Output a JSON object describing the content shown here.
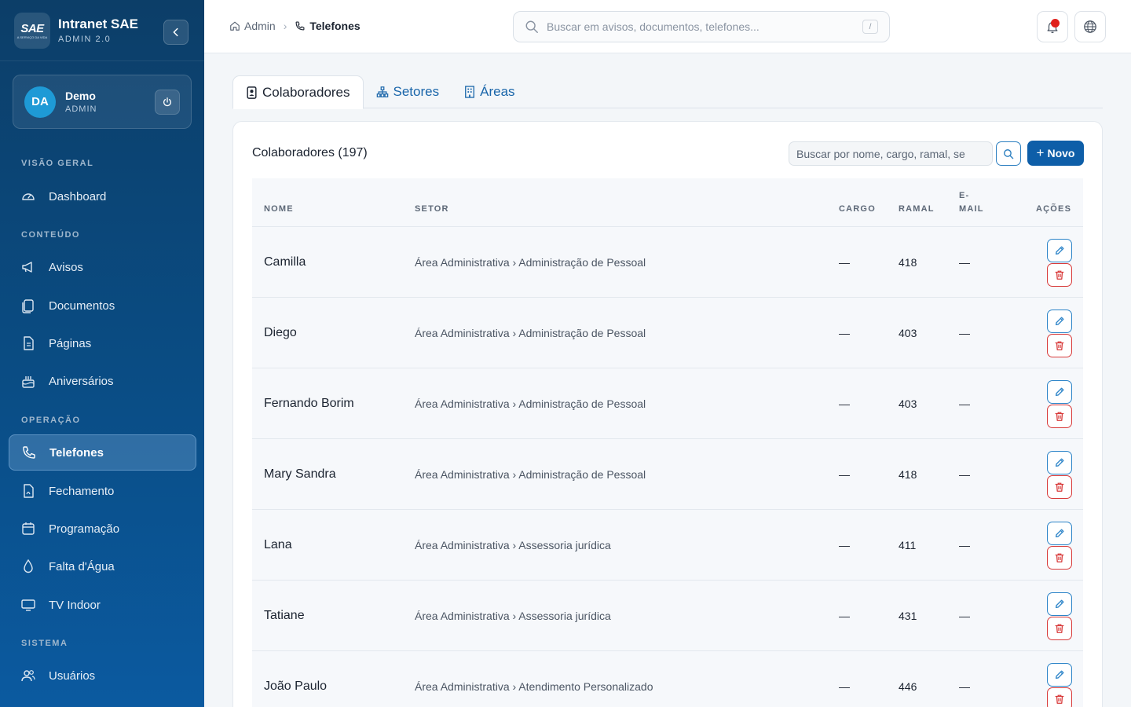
{
  "brand": {
    "logo_text": "SAE",
    "logo_tagline": "A SERVIÇO DA VIDA",
    "title": "Intranet SAE",
    "subtitle": "ADMIN 2.0"
  },
  "user": {
    "initials": "DA",
    "name": "Demo",
    "role": "ADMIN"
  },
  "sidebar": {
    "sections": [
      "VISÃO GERAL",
      "CONTEÚDO",
      "OPERAÇÃO",
      "SISTEMA"
    ],
    "items": [
      {
        "label": "Dashboard",
        "icon": "gauge-icon"
      },
      {
        "label": "Avisos",
        "icon": "megaphone-icon"
      },
      {
        "label": "Documentos",
        "icon": "documents-icon"
      },
      {
        "label": "Páginas",
        "icon": "page-icon"
      },
      {
        "label": "Aniversários",
        "icon": "cake-icon"
      },
      {
        "label": "Telefones",
        "icon": "phone-icon",
        "active": true
      },
      {
        "label": "Fechamento",
        "icon": "file-pdf-icon"
      },
      {
        "label": "Programação",
        "icon": "calendar-icon"
      },
      {
        "label": "Falta d'Água",
        "icon": "droplet-icon"
      },
      {
        "label": "TV Indoor",
        "icon": "monitor-icon"
      },
      {
        "label": "Usuários",
        "icon": "users-icon"
      }
    ]
  },
  "breadcrumb": {
    "root": "Admin",
    "current": "Telefones"
  },
  "search": {
    "placeholder": "Buscar em avisos, documentos, telefones...",
    "shortcut": "/"
  },
  "tabs": [
    {
      "label": "Colaboradores",
      "active": true
    },
    {
      "label": "Setores"
    },
    {
      "label": "Áreas"
    }
  ],
  "panel": {
    "title": "Colaboradores (197)",
    "search_placeholder": "Buscar por nome, cargo, ramal, se",
    "new_label": "Novo"
  },
  "table": {
    "headers": {
      "nome": "NOME",
      "setor": "SETOR",
      "cargo": "CARGO",
      "ramal": "RAMAL",
      "email_1": "E-",
      "email_2": "MAIL",
      "acoes": "AÇÕES"
    },
    "rows": [
      {
        "nome": "Camilla",
        "setor": "Área Administrativa › Administração de Pessoal",
        "cargo": "—",
        "ramal": "418",
        "email": "—"
      },
      {
        "nome": "Diego",
        "setor": "Área Administrativa › Administração de Pessoal",
        "cargo": "—",
        "ramal": "403",
        "email": "—"
      },
      {
        "nome": "Fernando Borim",
        "setor": "Área Administrativa › Administração de Pessoal",
        "cargo": "—",
        "ramal": "403",
        "email": "—"
      },
      {
        "nome": "Mary Sandra",
        "setor": "Área Administrativa › Administração de Pessoal",
        "cargo": "—",
        "ramal": "418",
        "email": "—"
      },
      {
        "nome": "Lana",
        "setor": "Área Administrativa › Assessoria jurídica",
        "cargo": "—",
        "ramal": "411",
        "email": "—"
      },
      {
        "nome": "Tatiane",
        "setor": "Área Administrativa › Assessoria jurídica",
        "cargo": "—",
        "ramal": "431",
        "email": "—"
      },
      {
        "nome": "João Paulo",
        "setor": "Área Administrativa › Atendimento Personalizado",
        "cargo": "—",
        "ramal": "446",
        "email": "—"
      }
    ]
  },
  "colors": {
    "sidebar_dark": "#0c3e68",
    "primary": "#0e5ea8",
    "danger": "#d83a3a",
    "notification": "#e0201b"
  }
}
